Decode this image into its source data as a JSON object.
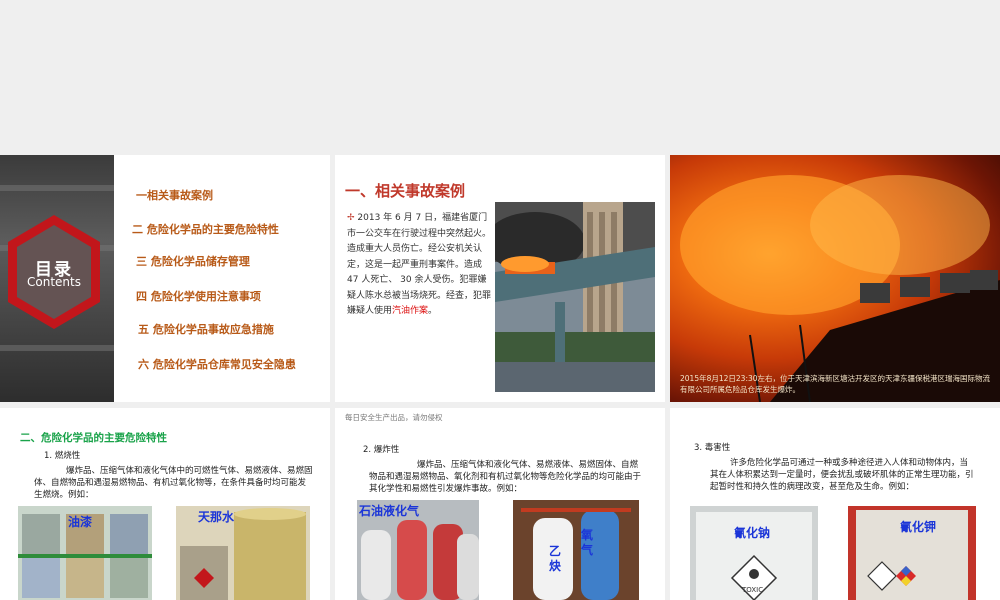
{
  "slide1": {
    "toc_title": "目录",
    "toc_subtitle": "Contents",
    "items": [
      "一相关事故案例",
      "二  危险化学品的主要危险特性",
      "三   危险化学品储存管理",
      "四  危险化学使用注意事项",
      "五  危险化学品事故应急措施",
      "六  危险化学品仓库常见安全隐患"
    ]
  },
  "slide2": {
    "title": "一、相关事故案例",
    "body_before": "2013 年 6 月 7 日，福建省厦门市一公交车在行驶过程中突然起火。造成重大人员伤亡。经公安机关认定，这是一起严重刑事案件。造成 47 人死亡、 30 余人受伤。犯罪嫌疑人陈水总被当场烧死。经查，犯罪嫌疑人使用",
    "body_highlight": "汽油作案",
    "body_after": "。"
  },
  "slide3": {
    "caption": "2015年8月12日23:30左右，位于天津滨海新区塘沽开发区的天津东疆保税港区瑞海国际物流有限公司所属危险品仓库发生爆炸。"
  },
  "slide4": {
    "heading": "二、危险化学品的主要危险特性",
    "subheading": "1.    燃烧性",
    "paragraph": "爆炸品、压缩气体和液化气体中的可燃性气体、易燃液体、易燃固体、自燃物品和遇湿易燃物品、有机过氧化物等，在条件具备时均可能发生燃烧。例如：",
    "labels": [
      "油漆",
      "天那水"
    ]
  },
  "slide5": {
    "top_note": "每日安全生产出品，请勿侵权",
    "subheading": "2.  爆炸性",
    "paragraph": "爆炸品、压缩气体和液化气体、易燃液体、易燃固体、自燃物品和遇湿易燃物品、氧化剂和有机过氧化物等危险化学品的均可能由于其化学性和易燃性引发爆炸事故。例如：",
    "labels": [
      "石油液化气",
      "乙炔",
      "氧气"
    ]
  },
  "slide6": {
    "subheading": "3.  毒害性",
    "paragraph": "许多危险化学品可通过一种或多种途径进入人体和动物体内，当其在人体积累达到一定量时，便会扰乱或破坏肌体的正常生理功能，引起暂时性和持久性的病理改变，甚至危及生命。例如：",
    "labels": [
      "氰化钠",
      "氰化钾"
    ]
  },
  "colors": {
    "orange_title": "#b85a18",
    "red_title": "#c0392b",
    "green_heading": "#1aa34a",
    "blue_label": "#1b35d8",
    "hexagon_red": "#c2161b"
  }
}
